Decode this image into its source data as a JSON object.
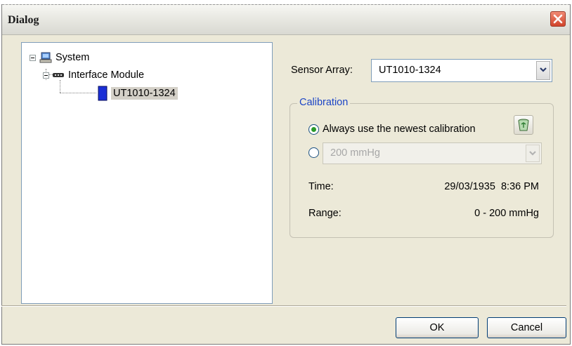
{
  "window": {
    "title": "Dialog"
  },
  "tree": {
    "root": {
      "label": "System",
      "icon": "computer-icon"
    },
    "child": {
      "label": "Interface Module",
      "icon": "interface-module-icon"
    },
    "leaf": {
      "label": "UT1010-1324",
      "icon": "sensor-icon",
      "selected": true
    }
  },
  "sensor_array": {
    "label": "Sensor Array:",
    "value": "UT1010-1324"
  },
  "calibration": {
    "legend": "Calibration",
    "option_newest": {
      "label": "Always use the newest calibration",
      "checked": true
    },
    "option_specific": {
      "value": "200 mmHg",
      "checked": false,
      "disabled": true
    },
    "recycle_icon": "recycle-bin-icon",
    "time_label": "Time:",
    "time_value": "29/03/1935  8:36 PM",
    "range_label": "Range:",
    "range_value": "0 - 200 mmHg"
  },
  "buttons": {
    "ok": "OK",
    "cancel": "Cancel"
  },
  "colors": {
    "accent": "#1c45c6",
    "close": "#d1442b",
    "background": "#ece9d8"
  }
}
